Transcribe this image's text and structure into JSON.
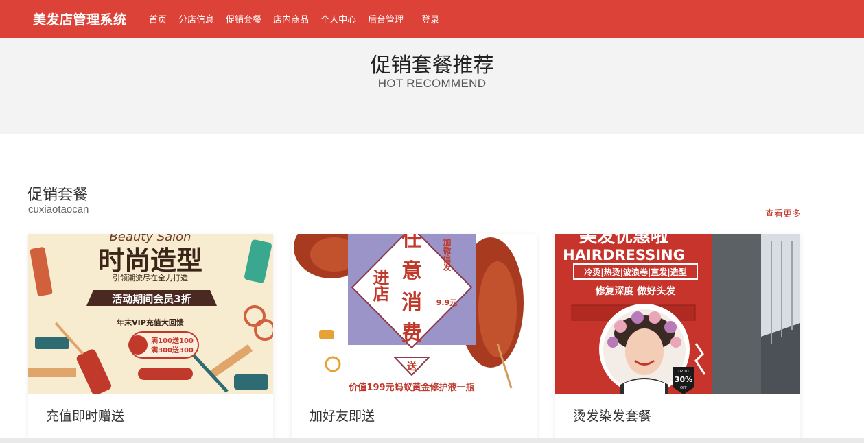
{
  "header": {
    "brand": "美发店管理系统",
    "nav": [
      "首页",
      "分店信息",
      "促销套餐",
      "店内商品",
      "个人中心",
      "后台管理",
      "登录"
    ]
  },
  "hero": {
    "title": "促销套餐推荐",
    "subtitle": "HOT RECOMMEND"
  },
  "section": {
    "title": "促销套餐",
    "subtitle": "cuxiaotaocan",
    "more": "查看更多"
  },
  "cards": [
    {
      "label": "充值即时赠送",
      "poster": {
        "script": "Beauty Salon",
        "headline": "时尚造型",
        "tagline": "引领潮流尽在全力打造",
        "ribbon": "活动期间会员3折",
        "note": "年末VIP充值大回馈",
        "badge_line1": "满100送100",
        "badge_line2": "满300送300"
      }
    },
    {
      "label": "加好友即送",
      "poster": {
        "big1": "任",
        "big2": "意",
        "big3": "消",
        "big4": "费",
        "left": "进店",
        "right": "加微信发",
        "price": "9.9元",
        "gift": "送",
        "footer": "价值199元蚂蚁黄金修护液一瓶"
      }
    },
    {
      "label": "烫发染发套餐",
      "poster": {
        "top": "美发优惠啦",
        "en": "HAIRDRESSING",
        "services": "冷烫|热烫|波浪卷|直发|造型",
        "slogan": "修复深度 做好头发",
        "discount": "30%",
        "off": "OFF",
        "upto": "UP TO"
      }
    }
  ],
  "colors": {
    "brand": "#dd4239",
    "hero_bg": "#f3f3f3",
    "link": "#c0392b"
  }
}
